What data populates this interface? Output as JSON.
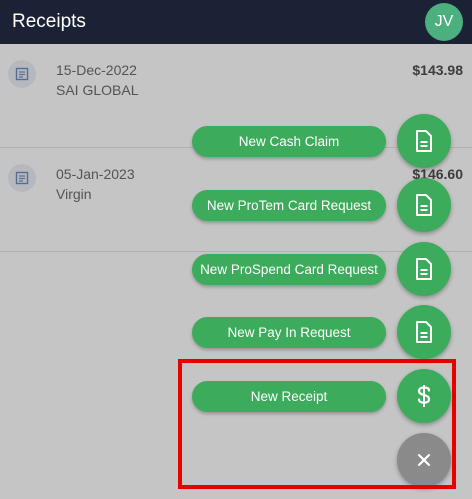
{
  "header": {
    "title": "Receipts",
    "avatar_initials": "JV"
  },
  "receipts": [
    {
      "date": "15-Dec-2022",
      "vendor": "SAI GLOBAL",
      "amount": "$143.98"
    },
    {
      "date": "05-Jan-2023",
      "vendor": "Virgin",
      "amount": "$146.60"
    }
  ],
  "fab_menu": {
    "items": [
      {
        "label": "New Cash Claim",
        "icon": "document-icon"
      },
      {
        "label": "New ProTem Card Request",
        "icon": "document-icon"
      },
      {
        "label": "New ProSpend Card Request",
        "icon": "document-icon"
      },
      {
        "label": "New Pay In Request",
        "icon": "document-icon"
      },
      {
        "label": "New Receipt",
        "icon": "dollar-icon"
      }
    ],
    "close_icon": "close-icon"
  },
  "colors": {
    "app_bar": "#1c2236",
    "avatar": "#4caf7e",
    "fab_green": "#3cab5c",
    "close_button": "#8a8a8a",
    "highlight": "#e60000"
  }
}
